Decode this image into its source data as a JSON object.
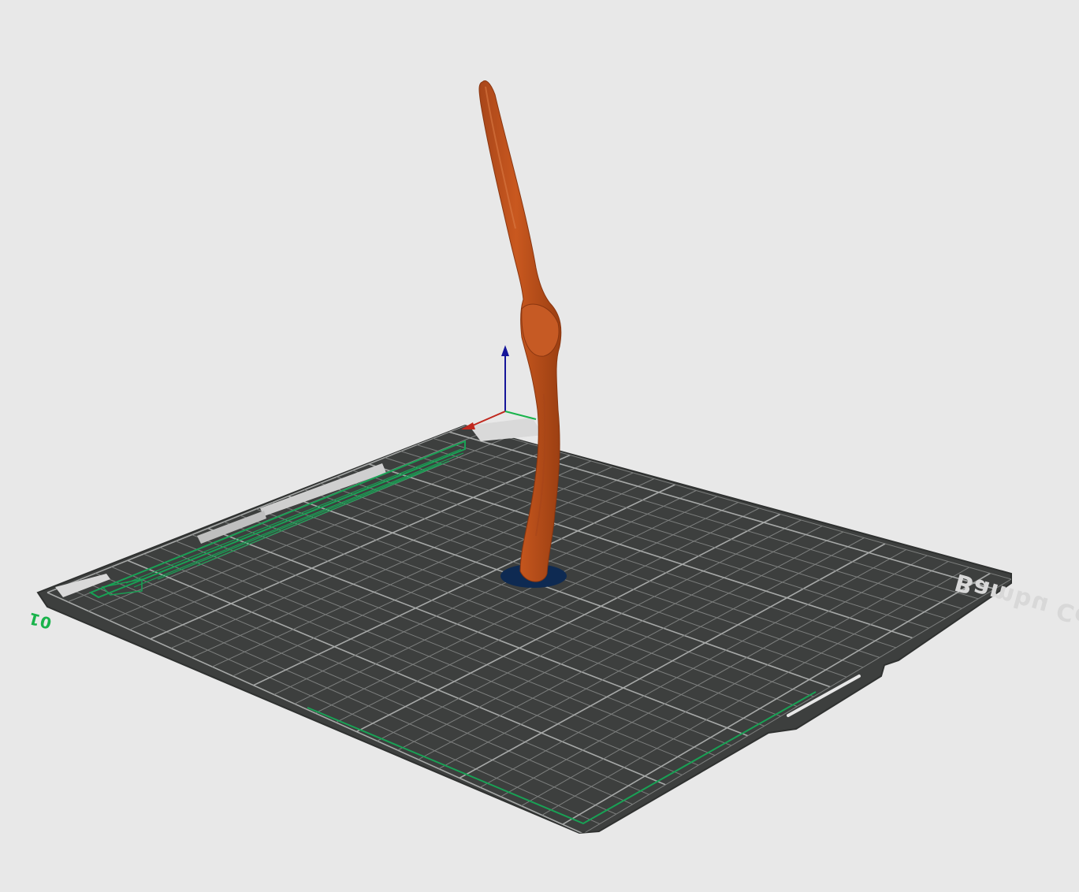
{
  "scene": {
    "plate_name": "Bambu Cool Plate",
    "plate_index": "01",
    "object": "wand-model",
    "colors": {
      "background": "#e8e8e8",
      "plate": "#3d3f3e",
      "grid_line": "#8a8c8b",
      "object": "#c0521c",
      "object_shadow": "#9b3f12",
      "brim": "#0e2a52",
      "axis_x": "#c0281e",
      "axis_y": "#19b34b",
      "axis_z": "#15159a",
      "print_area_outline": "#19a155",
      "plate_index_color": "#19b34b"
    }
  }
}
